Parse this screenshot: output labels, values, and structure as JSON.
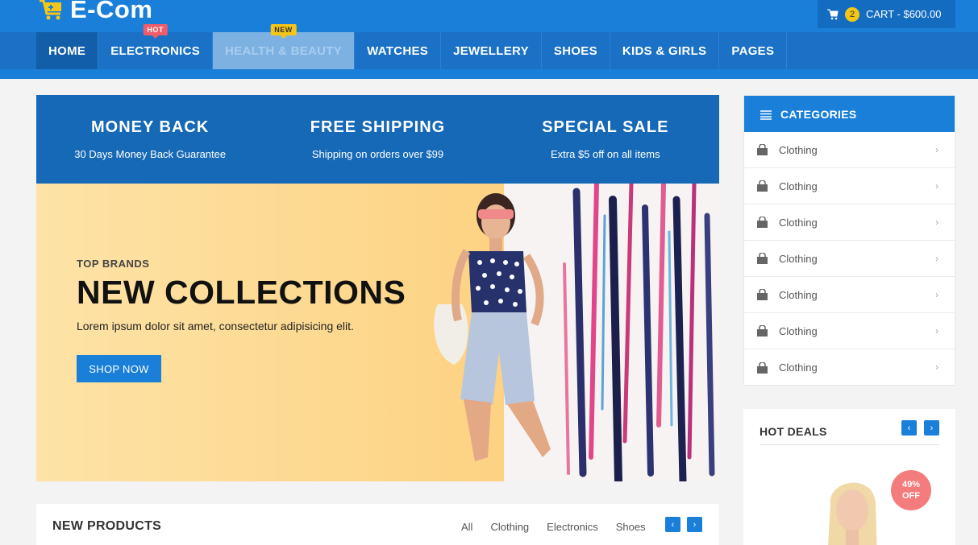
{
  "header": {
    "logo_text": "E-Com",
    "cart": {
      "count": "2",
      "label": "CART - $600.00"
    }
  },
  "nav": {
    "items": [
      {
        "label": "HOME",
        "state": "active"
      },
      {
        "label": "ELECTRONICS",
        "tag": "HOT"
      },
      {
        "label": "HEALTH & BEAUTY",
        "tag": "NEW",
        "state": "faded"
      },
      {
        "label": "WATCHES"
      },
      {
        "label": "JEWELLERY"
      },
      {
        "label": "SHOES"
      },
      {
        "label": "KIDS & GIRLS"
      },
      {
        "label": "PAGES"
      }
    ]
  },
  "features": [
    {
      "title": "MONEY BACK",
      "subtitle": "30 Days Money Back Guarantee"
    },
    {
      "title": "FREE SHIPPING",
      "subtitle": "Shipping on orders over $99"
    },
    {
      "title": "SPECIAL SALE",
      "subtitle": "Extra $5 off on all items"
    }
  ],
  "banner": {
    "eyebrow": "TOP BRANDS",
    "title": "NEW COLLECTIONS",
    "description": "Lorem ipsum dolor sit amet, consectetur adipisicing elit.",
    "button": "SHOP NOW"
  },
  "categories": {
    "title": "CATEGORIES",
    "items": [
      "Clothing",
      "Clothing",
      "Clothing",
      "Clothing",
      "Clothing",
      "Clothing",
      "Clothing"
    ]
  },
  "hot_deals": {
    "title": "HOT DEALS",
    "discount_value": "49%",
    "discount_label": "OFF"
  },
  "new_products": {
    "title": "NEW PRODUCTS",
    "filters": [
      "All",
      "Clothing",
      "Electronics",
      "Shoes"
    ]
  },
  "colors": {
    "primary": "#1a7fd8",
    "nav_bg": "#1a71c5",
    "hot_tag": "#f15c6a",
    "new_tag": "#f5c518"
  }
}
